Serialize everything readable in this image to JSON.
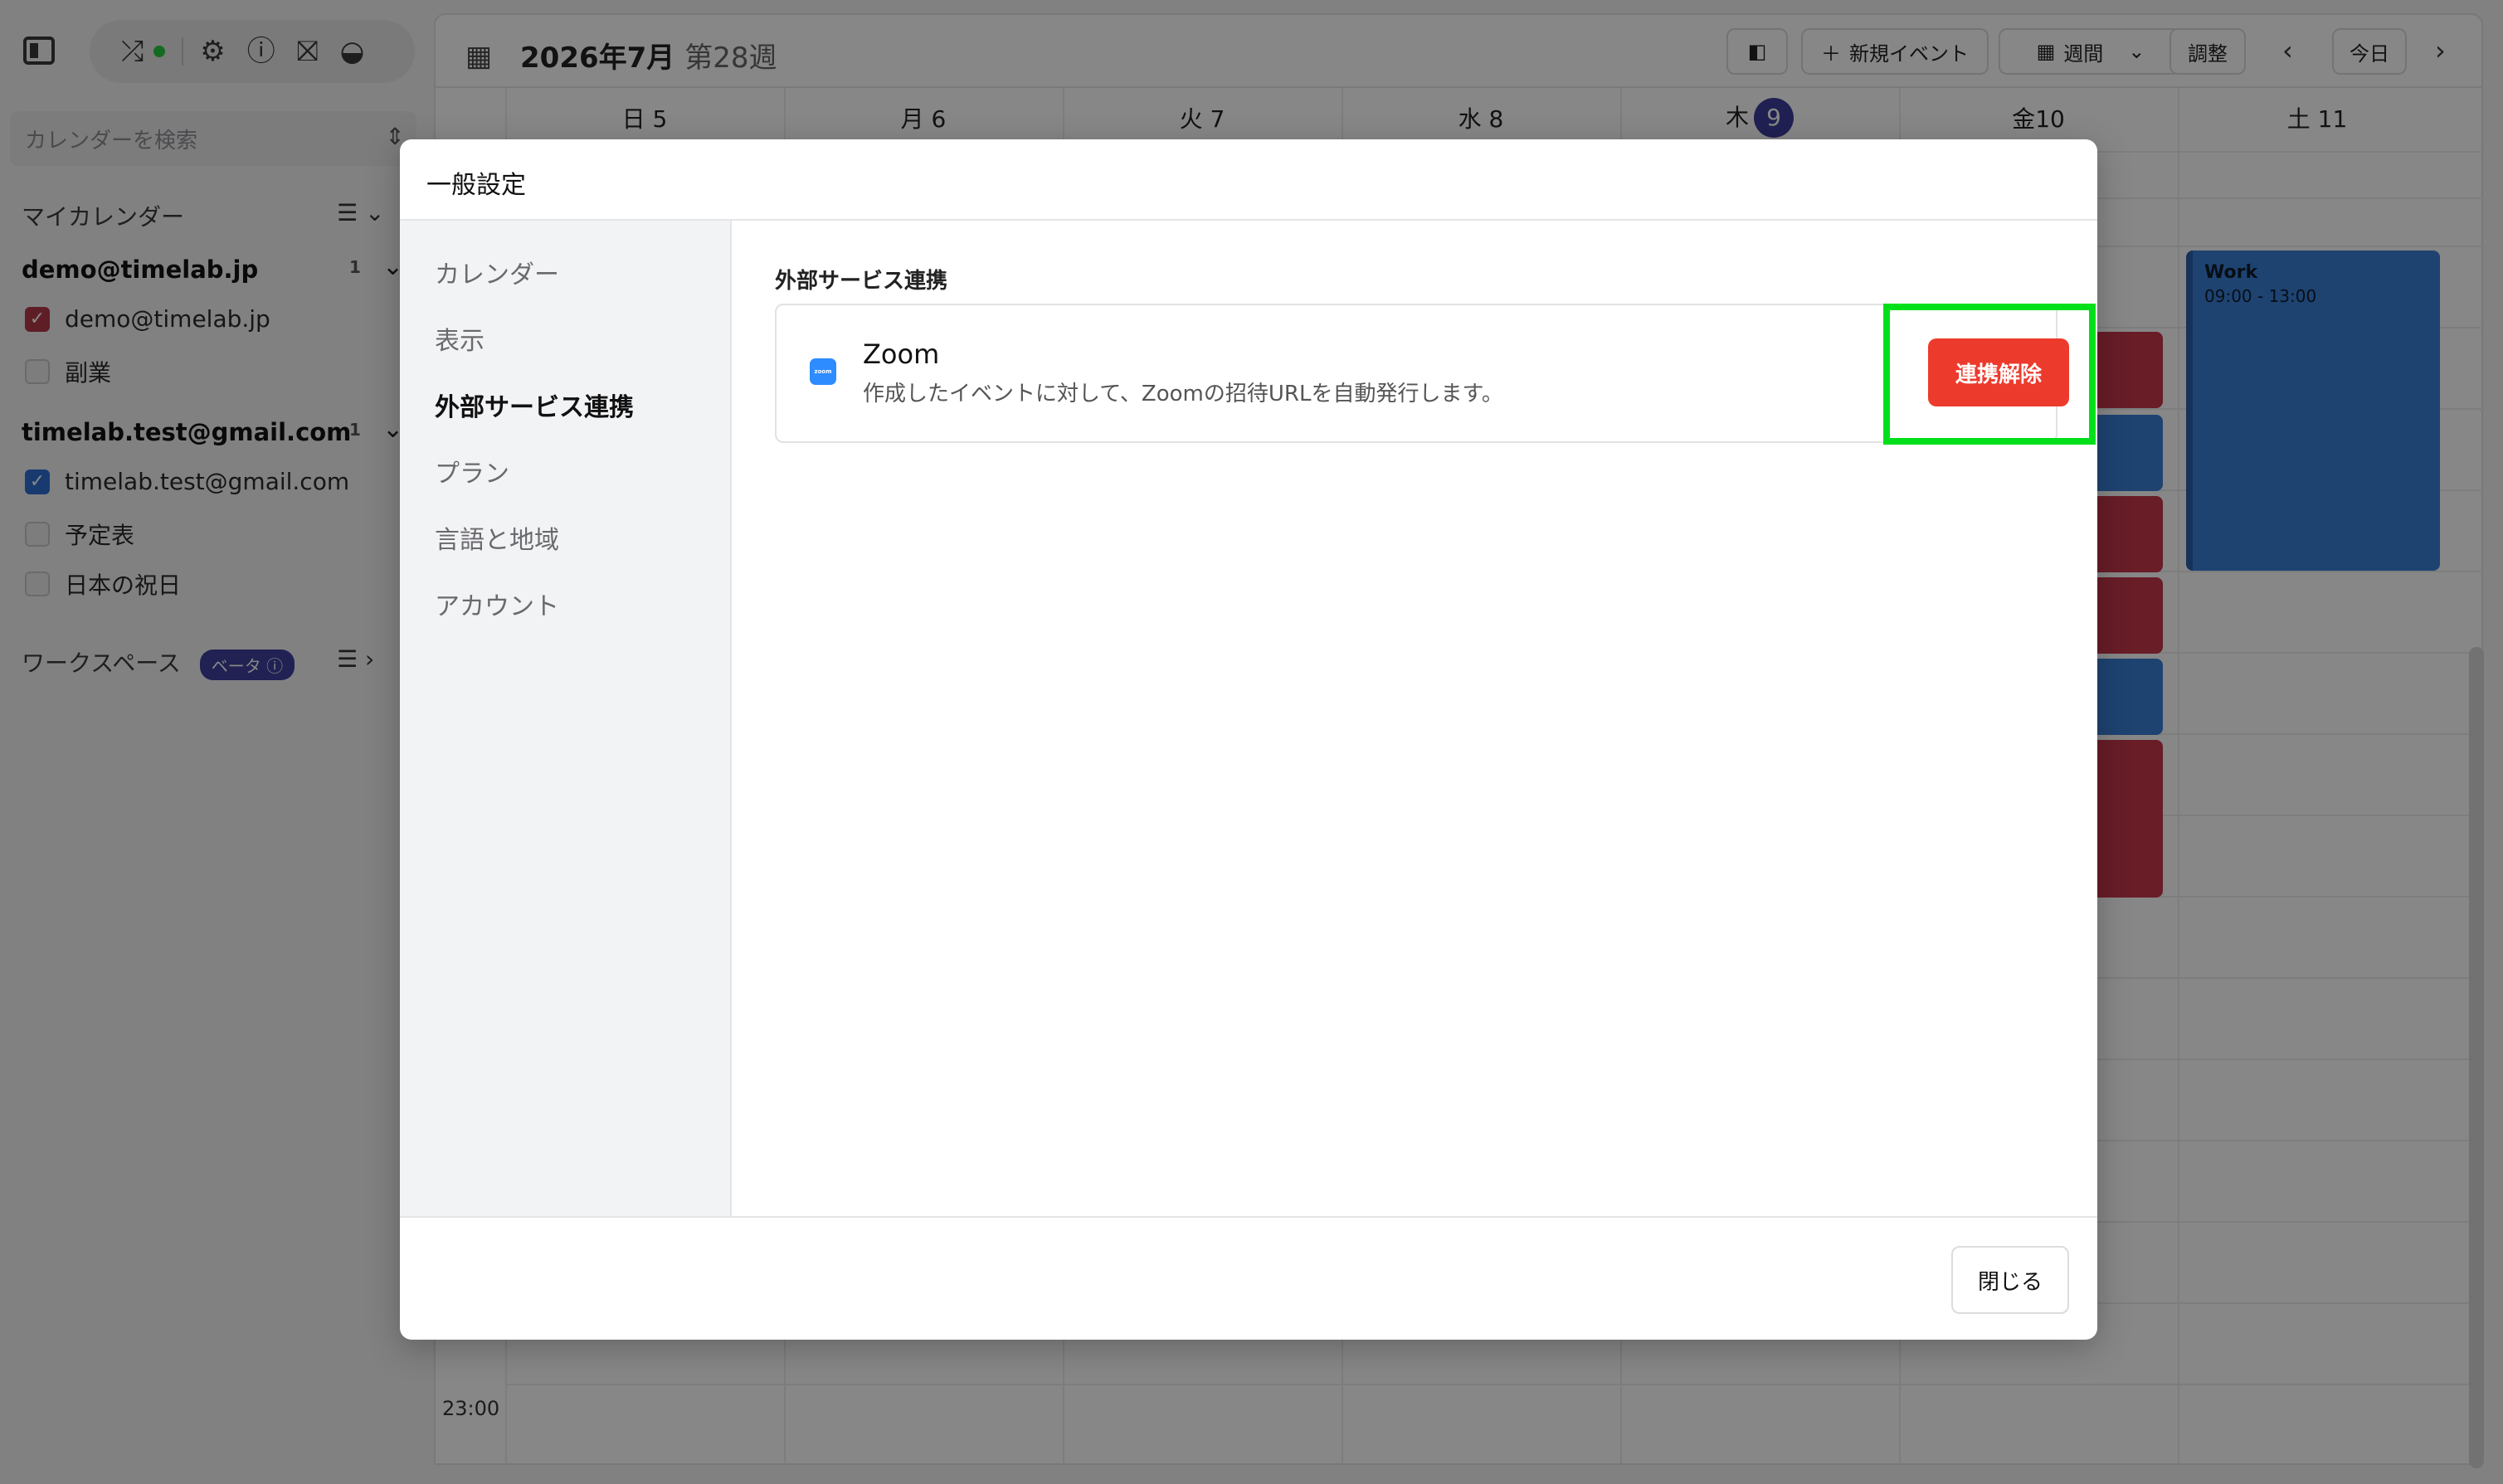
{
  "sidebar": {
    "search_placeholder": "カレンダーを検索",
    "my_calendars_heading": "マイカレンダー",
    "accounts": [
      {
        "email": "demo@timelab.jp",
        "count": "1",
        "calendars": [
          {
            "label": "demo@timelab.jp",
            "checked": true,
            "color": "#b33a48"
          },
          {
            "label": "副業",
            "checked": false
          }
        ]
      },
      {
        "email": "timelab.test@gmail.com",
        "count": "1",
        "calendars": [
          {
            "label": "timelab.test@gmail.com",
            "checked": true,
            "color": "#2f6fd1"
          },
          {
            "label": "予定表",
            "checked": false
          },
          {
            "label": "日本の祝日",
            "checked": false
          }
        ]
      }
    ],
    "workspace_heading": "ワークスペース",
    "workspace_badge": "ベータ"
  },
  "calendar": {
    "title": "2026年7月",
    "week_label": "第28週",
    "toolbar": {
      "new_event": "新規イベント",
      "view": "週間",
      "adjust": "調整",
      "today": "今日"
    },
    "days": [
      {
        "dow": "日",
        "date": "5"
      },
      {
        "dow": "月",
        "date": "6"
      },
      {
        "dow": "火",
        "date": "7"
      },
      {
        "dow": "水",
        "date": "8"
      },
      {
        "dow": "木",
        "date": "9"
      },
      {
        "dow": "金",
        "date": "10"
      },
      {
        "dow": "土",
        "date": "11"
      }
    ],
    "time_label_last": "23:00",
    "event_work": {
      "title": "Work",
      "time": "09:00 - 13:00"
    }
  },
  "modal": {
    "title": "一般設定",
    "nav": [
      "カレンダー",
      "表示",
      "外部サービス連携",
      "プラン",
      "言語と地域",
      "アカウント"
    ],
    "active_nav": "外部サービス連携",
    "section_title": "外部サービス連携",
    "integration": {
      "name": "Zoom",
      "logo_text": "zoom",
      "description": "作成したイベントに対して、Zoomの招待URLを自動発行します。",
      "action_label": "連携解除"
    },
    "close_label": "閉じる"
  },
  "colors": {
    "accent_red": "#ec3b2d",
    "highlight_green": "#00e01a",
    "today_badge": "#3e3e9e",
    "event_red": "#c4384a",
    "event_blue": "#3a7fd6"
  }
}
